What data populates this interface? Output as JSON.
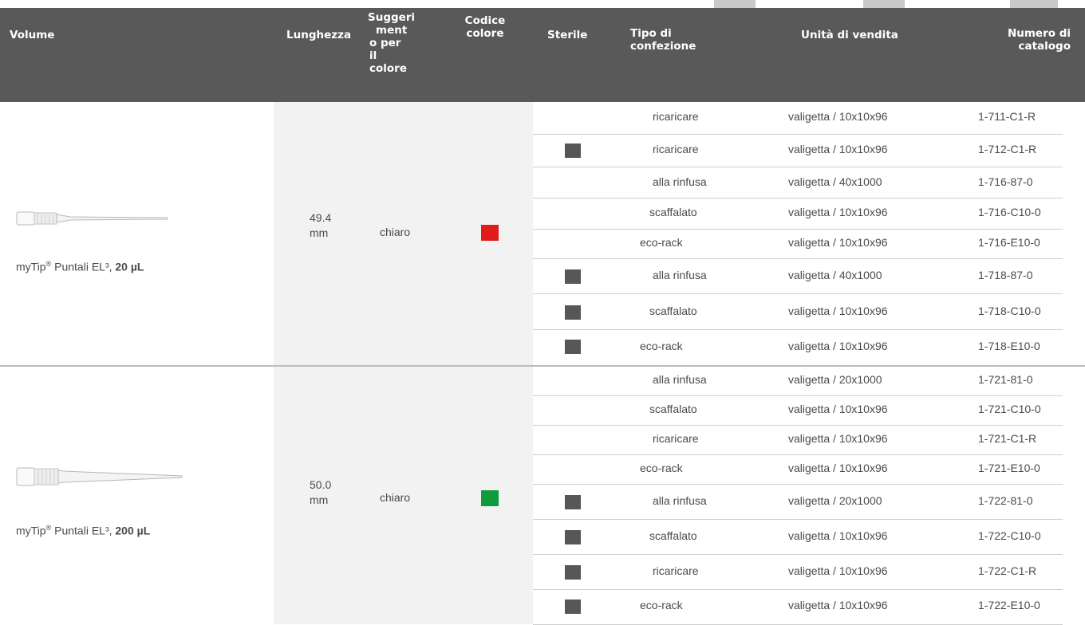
{
  "headers": {
    "volume": "Volume",
    "lunghezza": "Lunghezza",
    "suggerimento": [
      "Suggeri",
      "ment",
      "o per",
      "il",
      "colore"
    ],
    "codice": [
      "Codice",
      "colore"
    ],
    "sterile": "Sterile",
    "tipo": [
      "Tipo di",
      "confezione"
    ],
    "unita": "Unità di vendita",
    "numero": [
      "Numero di",
      "catalogo"
    ]
  },
  "products": [
    {
      "name_prefix": "myTip",
      "reg": "®",
      "name_mid": " Puntali EL³, ",
      "volume": "20 µL",
      "length": "49.4 mm",
      "tip_color": "chiaro",
      "code_color": "#e01b1b",
      "rows": [
        {
          "sterile": false,
          "tipo": "ricaricare",
          "unita": "valigetta / 10x10x96",
          "catalogo": "1-711-C1-R"
        },
        {
          "sterile": true,
          "tipo": "ricaricare",
          "unita": "valigetta / 10x10x96",
          "catalogo": "1-712-C1-R"
        },
        {
          "sterile": false,
          "tipo": "alla rinfusa",
          "unita": "valigetta / 40x1000",
          "catalogo": "1-716-87-0"
        },
        {
          "sterile": false,
          "tipo": "scaffalato",
          "unita": "valigetta / 10x10x96",
          "catalogo": "1-716-C10-0"
        },
        {
          "sterile": false,
          "tipo": "eco-rack",
          "unita": "valigetta / 10x10x96",
          "catalogo": "1-716-E10-0"
        },
        {
          "sterile": true,
          "tipo": "alla rinfusa",
          "unita": "valigetta / 40x1000",
          "catalogo": "1-718-87-0"
        },
        {
          "sterile": true,
          "tipo": "scaffalato",
          "unita": "valigetta / 10x10x96",
          "catalogo": "1-718-C10-0"
        },
        {
          "sterile": true,
          "tipo": "eco-rack",
          "unita": "valigetta / 10x10x96",
          "catalogo": "1-718-E10-0"
        }
      ]
    },
    {
      "name_prefix": "myTip",
      "reg": "®",
      "name_mid": " Puntali EL³, ",
      "volume": "200 µL",
      "length": "50.0 mm",
      "tip_color": "chiaro",
      "code_color": "#0f9a3c",
      "rows": [
        {
          "sterile": false,
          "tipo": "alla rinfusa",
          "unita": "valigetta / 20x1000",
          "catalogo": "1-721-81-0"
        },
        {
          "sterile": false,
          "tipo": "scaffalato",
          "unita": "valigetta / 10x10x96",
          "catalogo": "1-721-C10-0"
        },
        {
          "sterile": false,
          "tipo": "ricaricare",
          "unita": "valigetta / 10x10x96",
          "catalogo": "1-721-C1-R"
        },
        {
          "sterile": false,
          "tipo": "eco-rack",
          "unita": "valigetta / 10x10x96",
          "catalogo": "1-721-E10-0"
        },
        {
          "sterile": true,
          "tipo": "alla rinfusa",
          "unita": "valigetta / 20x1000",
          "catalogo": "1-722-81-0"
        },
        {
          "sterile": true,
          "tipo": "scaffalato",
          "unita": "valigetta / 10x10x96",
          "catalogo": "1-722-C10-0"
        },
        {
          "sterile": true,
          "tipo": "ricaricare",
          "unita": "valigetta / 10x10x96",
          "catalogo": "1-722-C1-R"
        },
        {
          "sterile": true,
          "tipo": "eco-rack",
          "unita": "valigetta / 10x10x96",
          "catalogo": "1-722-E10-0"
        }
      ]
    }
  ],
  "colors": {
    "header_bg": "#595959",
    "sterile_square": "#575757",
    "shaded_column": "#f2f2f2"
  }
}
